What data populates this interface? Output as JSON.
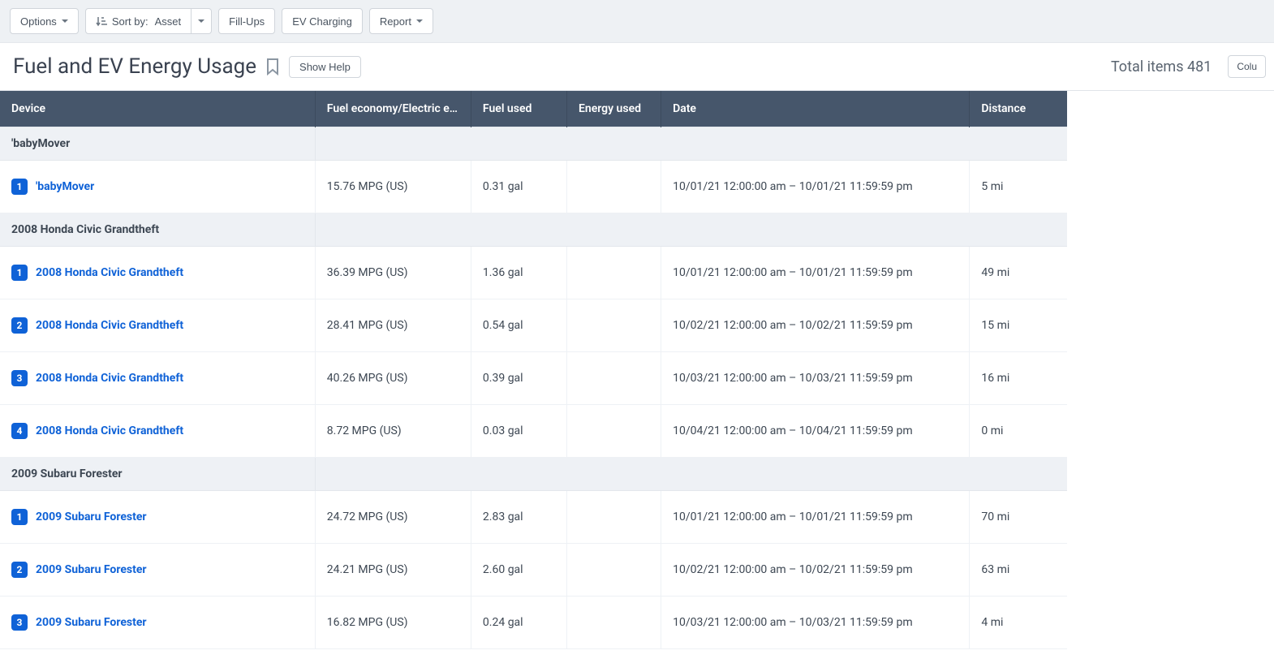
{
  "toolbar": {
    "options_label": "Options",
    "sort_prefix": "Sort by:",
    "sort_value": "Asset",
    "fillups_label": "Fill-Ups",
    "ev_charging_label": "EV Charging",
    "report_label": "Report"
  },
  "header": {
    "title": "Fuel and EV Energy Usage",
    "show_help_label": "Show Help",
    "total_items_prefix": "Total items",
    "total_items_count": "481",
    "columns_label": "Colu"
  },
  "columns": {
    "device": "Device",
    "economy": "Fuel economy/Electric e…",
    "fuel_used": "Fuel used",
    "energy_used": "Energy used",
    "date": "Date",
    "distance": "Distance"
  },
  "groups": [
    {
      "name": "'babyMover",
      "rows": [
        {
          "idx": "1",
          "device": "'babyMover",
          "economy": "15.76 MPG (US)",
          "fuel": "0.31 gal",
          "energy": "",
          "date": "10/01/21 12:00:00 am – 10/01/21 11:59:59 pm",
          "distance": "5 mi"
        }
      ]
    },
    {
      "name": "2008 Honda Civic Grandtheft",
      "rows": [
        {
          "idx": "1",
          "device": "2008 Honda Civic Grandtheft",
          "economy": "36.39 MPG (US)",
          "fuel": "1.36 gal",
          "energy": "",
          "date": "10/01/21 12:00:00 am – 10/01/21 11:59:59 pm",
          "distance": "49 mi"
        },
        {
          "idx": "2",
          "device": "2008 Honda Civic Grandtheft",
          "economy": "28.41 MPG (US)",
          "fuel": "0.54 gal",
          "energy": "",
          "date": "10/02/21 12:00:00 am – 10/02/21 11:59:59 pm",
          "distance": "15 mi"
        },
        {
          "idx": "3",
          "device": "2008 Honda Civic Grandtheft",
          "economy": "40.26 MPG (US)",
          "fuel": "0.39 gal",
          "energy": "",
          "date": "10/03/21 12:00:00 am – 10/03/21 11:59:59 pm",
          "distance": "16 mi"
        },
        {
          "idx": "4",
          "device": "2008 Honda Civic Grandtheft",
          "economy": "8.72 MPG (US)",
          "fuel": "0.03 gal",
          "energy": "",
          "date": "10/04/21 12:00:00 am – 10/04/21 11:59:59 pm",
          "distance": "0 mi"
        }
      ]
    },
    {
      "name": "2009 Subaru Forester",
      "rows": [
        {
          "idx": "1",
          "device": "2009 Subaru Forester",
          "economy": "24.72 MPG (US)",
          "fuel": "2.83 gal",
          "energy": "",
          "date": "10/01/21 12:00:00 am – 10/01/21 11:59:59 pm",
          "distance": "70 mi"
        },
        {
          "idx": "2",
          "device": "2009 Subaru Forester",
          "economy": "24.21 MPG (US)",
          "fuel": "2.60 gal",
          "energy": "",
          "date": "10/02/21 12:00:00 am – 10/02/21 11:59:59 pm",
          "distance": "63 mi"
        },
        {
          "idx": "3",
          "device": "2009 Subaru Forester",
          "economy": "16.82 MPG (US)",
          "fuel": "0.24 gal",
          "energy": "",
          "date": "10/03/21 12:00:00 am – 10/03/21 11:59:59 pm",
          "distance": "4 mi"
        }
      ]
    }
  ]
}
